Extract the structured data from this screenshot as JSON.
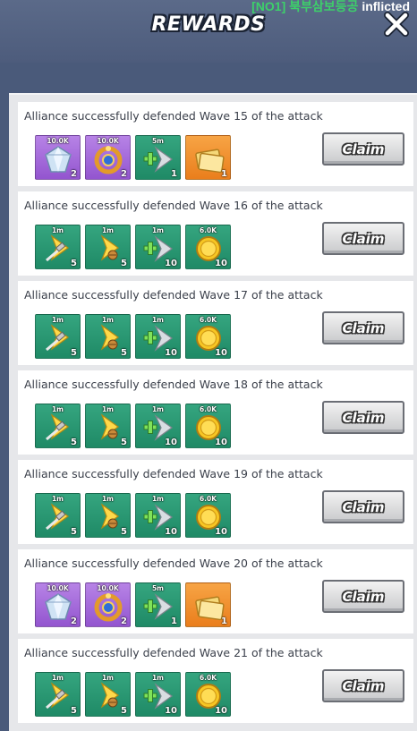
{
  "header": {
    "ticker_tag": "[NO1]",
    "ticker_korean": "북부삼보등공",
    "ticker_text": "inflicted",
    "title": "REWARDS",
    "close_icon": "close-icon"
  },
  "rows": [
    {
      "text": "Alliance successfully defended Wave 15 of the attack",
      "items": [
        {
          "icon": "diamond-icon",
          "color": "purple",
          "top": "10.0K",
          "qty": "2"
        },
        {
          "icon": "sapphire-ring-icon",
          "color": "purple",
          "top": "10.0K",
          "qty": "2"
        },
        {
          "icon": "speedup-plus-icon",
          "color": "green",
          "top": "5m",
          "qty": "1"
        },
        {
          "icon": "gold-ticket-icon",
          "color": "orange",
          "top": "",
          "qty": "1"
        }
      ],
      "claim": "Claim"
    },
    {
      "text": "Alliance successfully defended Wave 16 of the attack",
      "items": [
        {
          "icon": "hammer-speedup-icon",
          "color": "green",
          "top": "1m",
          "qty": "5"
        },
        {
          "icon": "training-speedup-icon",
          "color": "green",
          "top": "1m",
          "qty": "5"
        },
        {
          "icon": "speedup-plus-icon",
          "color": "green",
          "top": "1m",
          "qty": "10"
        },
        {
          "icon": "gold-coin-icon",
          "color": "green",
          "top": "6.0K",
          "qty": "10"
        }
      ],
      "claim": "Claim"
    },
    {
      "text": "Alliance successfully defended Wave 17 of the attack",
      "items": [
        {
          "icon": "hammer-speedup-icon",
          "color": "green",
          "top": "1m",
          "qty": "5"
        },
        {
          "icon": "training-speedup-icon",
          "color": "green",
          "top": "1m",
          "qty": "5"
        },
        {
          "icon": "speedup-plus-icon",
          "color": "green",
          "top": "1m",
          "qty": "10"
        },
        {
          "icon": "gold-coin-icon",
          "color": "green",
          "top": "6.0K",
          "qty": "10"
        }
      ],
      "claim": "Claim"
    },
    {
      "text": "Alliance successfully defended Wave 18 of the attack",
      "items": [
        {
          "icon": "hammer-speedup-icon",
          "color": "green",
          "top": "1m",
          "qty": "5"
        },
        {
          "icon": "training-speedup-icon",
          "color": "green",
          "top": "1m",
          "qty": "5"
        },
        {
          "icon": "speedup-plus-icon",
          "color": "green",
          "top": "1m",
          "qty": "10"
        },
        {
          "icon": "gold-coin-icon",
          "color": "green",
          "top": "6.0K",
          "qty": "10"
        }
      ],
      "claim": "Claim"
    },
    {
      "text": "Alliance successfully defended Wave 19 of the attack",
      "items": [
        {
          "icon": "hammer-speedup-icon",
          "color": "green",
          "top": "1m",
          "qty": "5"
        },
        {
          "icon": "training-speedup-icon",
          "color": "green",
          "top": "1m",
          "qty": "5"
        },
        {
          "icon": "speedup-plus-icon",
          "color": "green",
          "top": "1m",
          "qty": "10"
        },
        {
          "icon": "gold-coin-icon",
          "color": "green",
          "top": "6.0K",
          "qty": "10"
        }
      ],
      "claim": "Claim"
    },
    {
      "text": "Alliance successfully defended Wave 20 of the attack",
      "items": [
        {
          "icon": "diamond-icon",
          "color": "purple",
          "top": "10.0K",
          "qty": "2"
        },
        {
          "icon": "sapphire-ring-icon",
          "color": "purple",
          "top": "10.0K",
          "qty": "2"
        },
        {
          "icon": "speedup-plus-icon",
          "color": "green",
          "top": "5m",
          "qty": "1"
        },
        {
          "icon": "gold-ticket-icon",
          "color": "orange",
          "top": "",
          "qty": "1"
        }
      ],
      "claim": "Claim"
    },
    {
      "text": "Alliance successfully defended Wave 21 of the attack",
      "items": [
        {
          "icon": "hammer-speedup-icon",
          "color": "green",
          "top": "1m",
          "qty": "5"
        },
        {
          "icon": "training-speedup-icon",
          "color": "green",
          "top": "1m",
          "qty": "5"
        },
        {
          "icon": "speedup-plus-icon",
          "color": "green",
          "top": "1m",
          "qty": "10"
        },
        {
          "icon": "gold-coin-icon",
          "color": "green",
          "top": "6.0K",
          "qty": "10"
        }
      ],
      "claim": "Claim"
    }
  ]
}
